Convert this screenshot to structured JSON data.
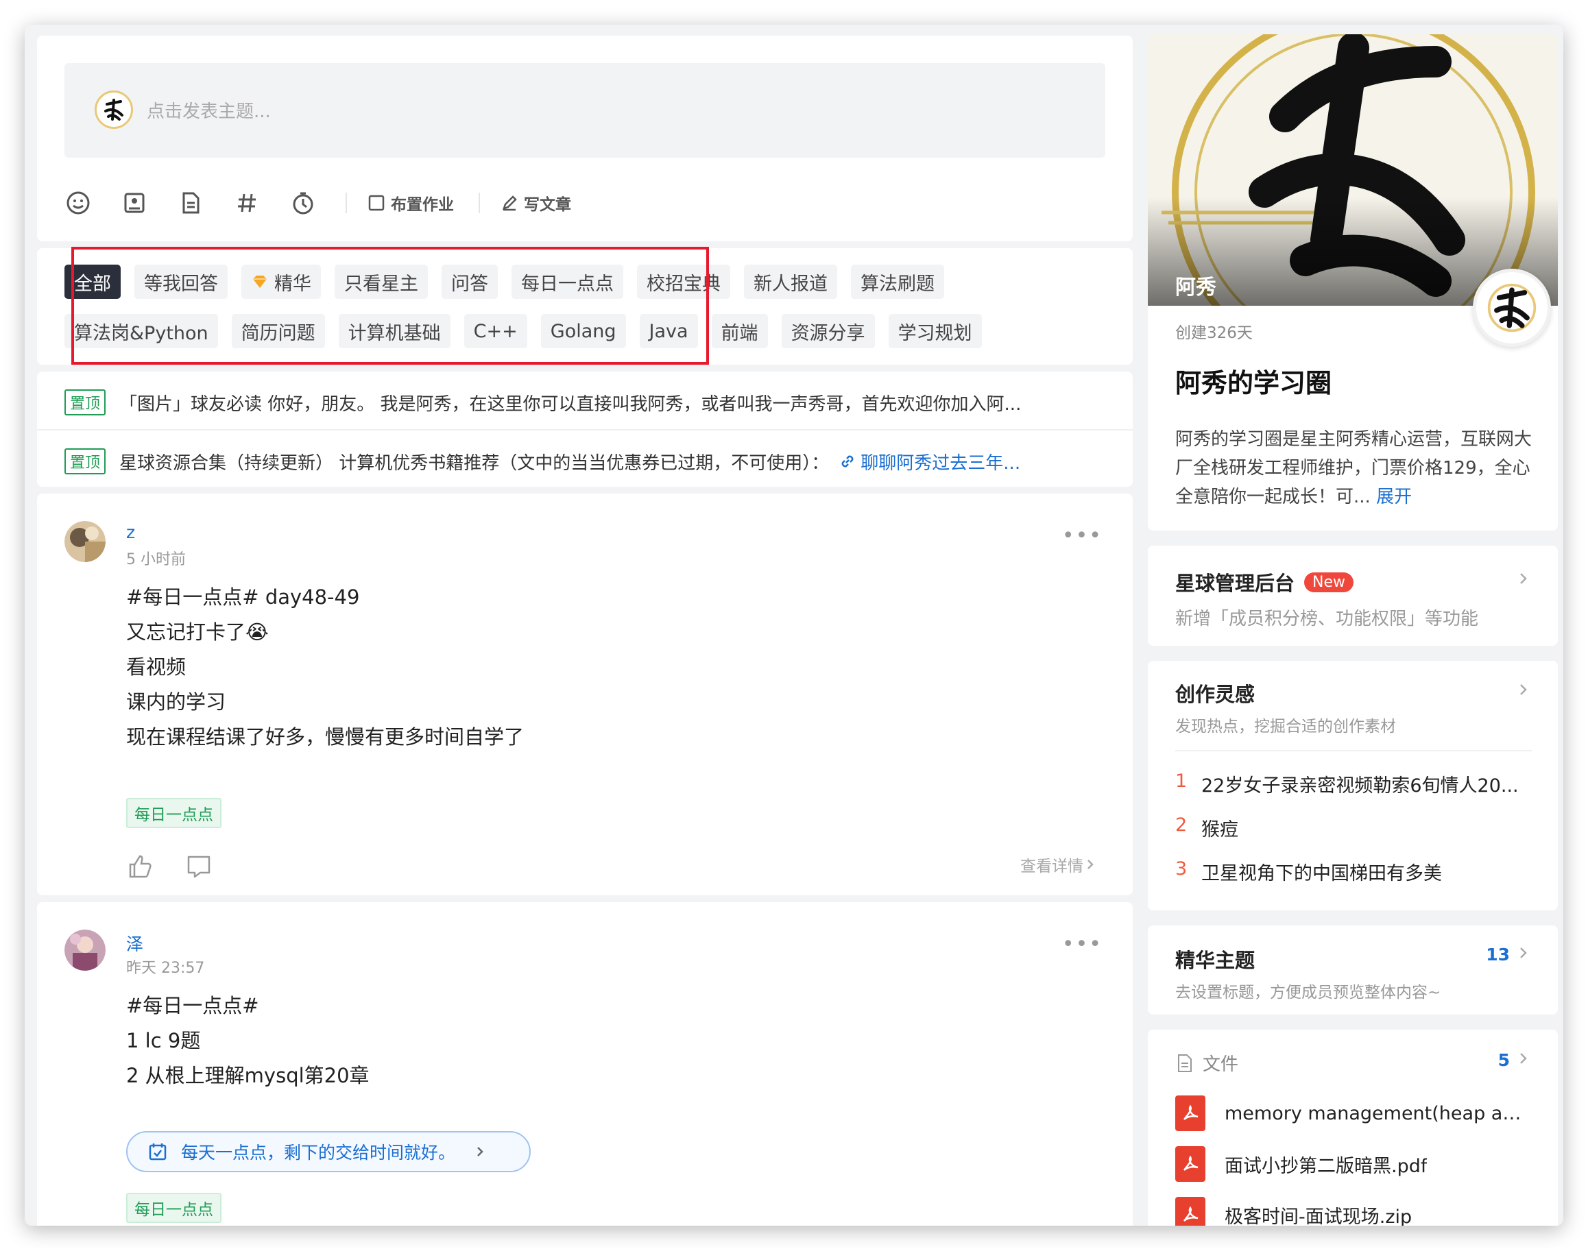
{
  "composer": {
    "placeholder": "点击发表主题...",
    "assignment_label": "布置作业",
    "article_label": "写文章"
  },
  "filters": {
    "row1": [
      "全部",
      "等我回答",
      "精华",
      "只看星主",
      "问答",
      "每日一点点",
      "校招宝典",
      "新人报道",
      "算法刷题"
    ],
    "row2": [
      "算法岗&Python",
      "简历问题",
      "计算机基础",
      "C++",
      "Golang",
      "Java",
      "前端",
      "资源分享",
      "学习规划"
    ],
    "active": "全部"
  },
  "pinned": [
    {
      "badge": "置顶",
      "text": "「图片」球友必读 你好，朋友。 我是阿秀，在这里你可以直接叫我阿秀，或者叫我一声秀哥，首先欢迎你加入阿..."
    },
    {
      "badge": "置顶",
      "text": "星球资源合集（持续更新） 计算机优秀书籍推荐（文中的当当优惠券已过期，不可使用）：",
      "link": "聊聊阿秀过去三年..."
    }
  ],
  "posts": [
    {
      "author": "z",
      "time": "5 小时前",
      "lines": [
        "#每日一点点# day48-49",
        "又忘记打卡了😭",
        "看视频",
        "课内的学习",
        "现在课程结课了好多，慢慢有更多时间自学了"
      ],
      "tag": "每日一点点",
      "detail": "查看详情"
    },
    {
      "author": "泽",
      "time": "昨天 23:57",
      "lines": [
        "#每日一点点#",
        "1 lc 9题",
        "2 从根上理解mysql第20章"
      ],
      "checkin": "每天一点点，剩下的交给时间就好。",
      "tag": "每日一点点"
    }
  ],
  "profile": {
    "banner_name": "阿秀",
    "created": "创建326天",
    "title": "阿秀的学习圈",
    "description": "阿秀的学习圈是星主阿秀精心运营，互联网大厂全栈研发工程师维护，门票价格129，全心全意陪你一起成长！可...",
    "expand": "展开"
  },
  "admin": {
    "title": "星球管理后台",
    "badge": "New",
    "subtitle": "新增「成员积分榜、功能权限」等功能"
  },
  "inspiration": {
    "title": "创作灵感",
    "subtitle": "发现热点，挖掘合适的创作素材",
    "items": [
      {
        "rank": "1",
        "text": "22岁女子录亲密视频勒索6旬情人20..."
      },
      {
        "rank": "2",
        "text": "猴痘"
      },
      {
        "rank": "3",
        "text": "卫星视角下的中国梯田有多美"
      }
    ]
  },
  "essence": {
    "title": "精华主题",
    "subtitle": "去设置标题，方便成员预览整体内容~",
    "count": "13"
  },
  "files": {
    "title": "文件",
    "count": "5",
    "items": [
      "memory management(heap and...",
      "面试小抄第二版暗黑.pdf",
      "极客时间-面试现场.zip"
    ]
  },
  "colors": {
    "accent": "#1a6fd1",
    "green": "#1f9d55",
    "highlight": "#e8192c",
    "active_tag": "#2b2f3c"
  }
}
